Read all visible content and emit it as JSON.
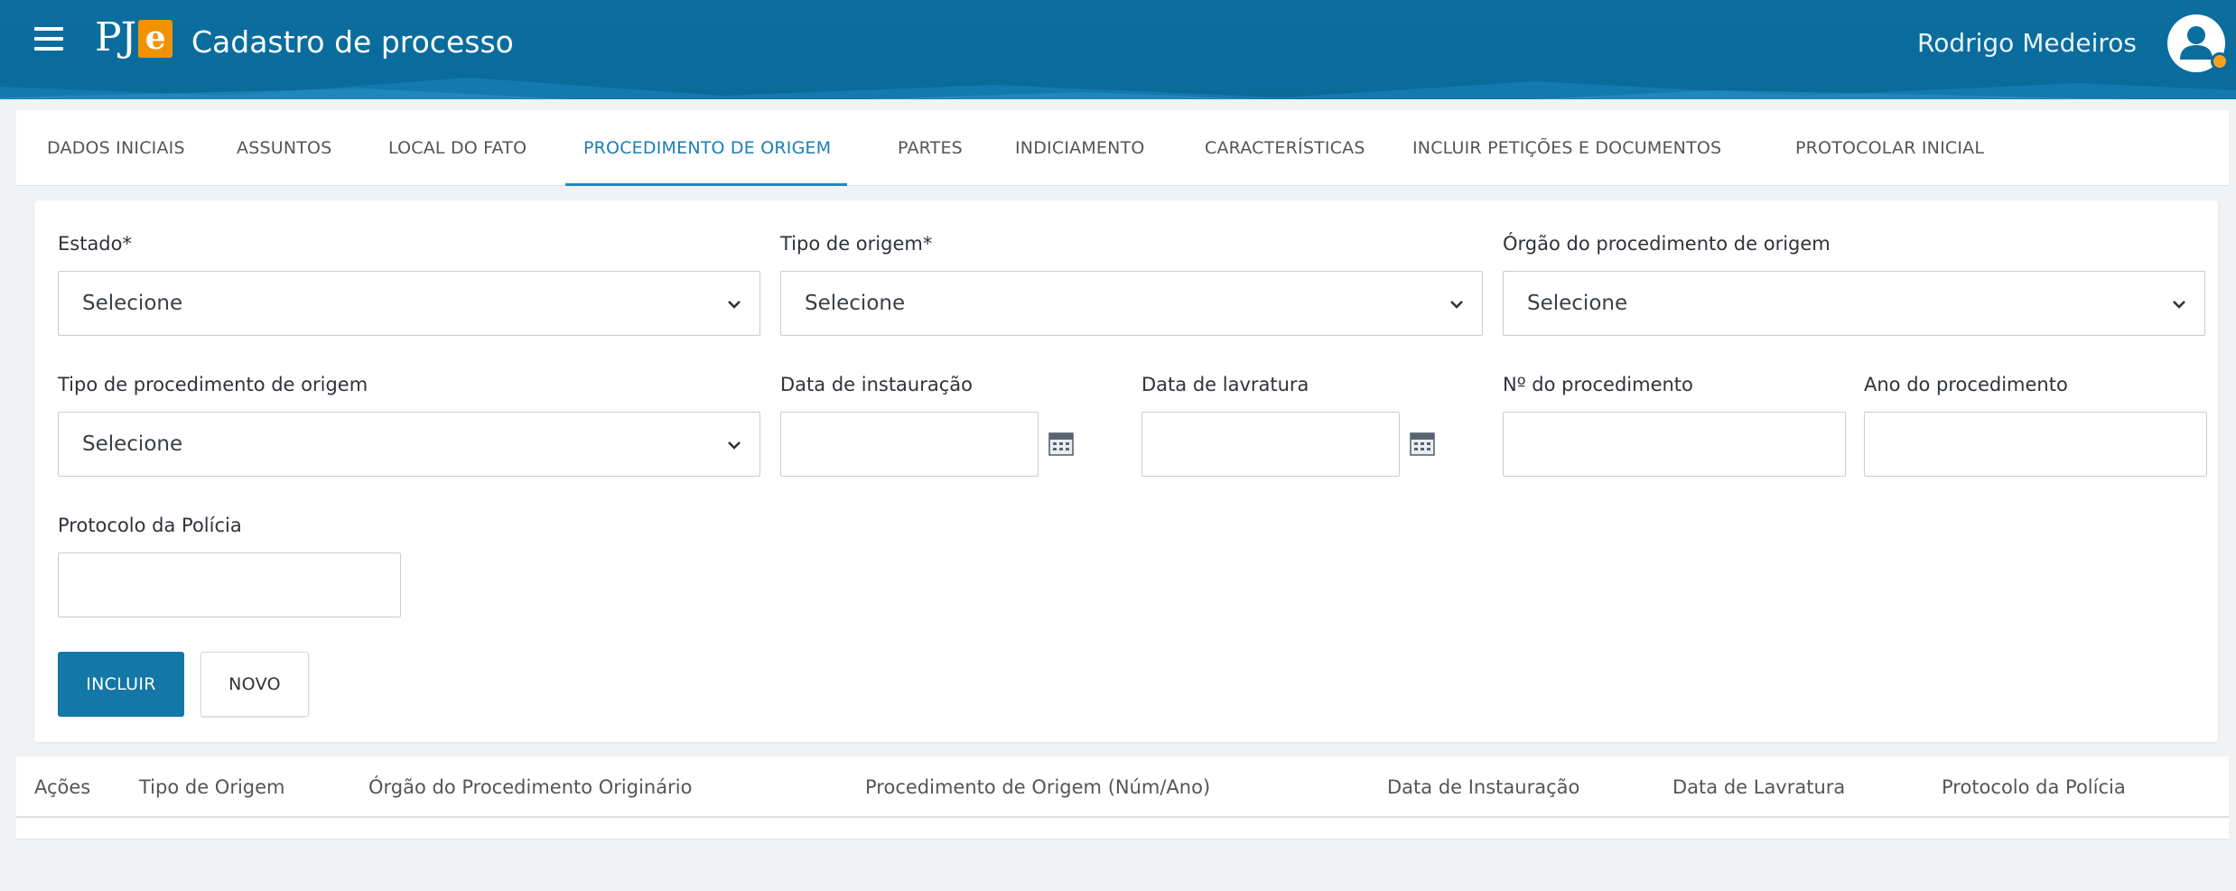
{
  "header": {
    "logo_text": "PJ",
    "logo_letter": "e",
    "title": "Cadastro de processo",
    "user_name": "Rodrigo Medeiros",
    "brand_color": "#0a6fa3",
    "accent_color": "#f39200"
  },
  "tabs": [
    {
      "label": "DADOS INICIAIS",
      "active": false
    },
    {
      "label": "ASSUNTOS",
      "active": false
    },
    {
      "label": "LOCAL DO FATO",
      "active": false
    },
    {
      "label": "PROCEDIMENTO DE ORIGEM",
      "active": true
    },
    {
      "label": "PARTES",
      "active": false
    },
    {
      "label": "INDICIAMENTO",
      "active": false
    },
    {
      "label": "CARACTERÍSTICAS",
      "active": false
    },
    {
      "label": "INCLUIR PETIÇÕES E DOCUMENTOS",
      "active": false
    },
    {
      "label": "PROTOCOLAR INICIAL",
      "active": false
    }
  ],
  "form": {
    "estado": {
      "label": "Estado*",
      "value": "Selecione"
    },
    "tipo_origem": {
      "label": "Tipo de origem*",
      "value": "Selecione"
    },
    "orgao": {
      "label": "Órgão do procedimento de origem",
      "value": "Selecione"
    },
    "tipo_procedimento": {
      "label": "Tipo de procedimento de origem",
      "value": "Selecione"
    },
    "data_instauracao": {
      "label": "Data de instauração",
      "value": ""
    },
    "data_lavratura": {
      "label": "Data de lavratura",
      "value": ""
    },
    "numero_procedimento": {
      "label": "Nº do procedimento",
      "value": ""
    },
    "ano_procedimento": {
      "label": "Ano do procedimento",
      "value": ""
    },
    "protocolo_policia": {
      "label": "Protocolo da Polícia",
      "value": ""
    }
  },
  "buttons": {
    "incluir": "INCLUIR",
    "novo": "NOVO"
  },
  "table": {
    "columns": [
      "Ações",
      "Tipo de Origem",
      "Órgão do Procedimento Originário",
      "Procedimento de Origem (Núm/Ano)",
      "Data de Instauração",
      "Data de Lavratura",
      "Protocolo da Polícia"
    ],
    "rows": []
  },
  "icons": {
    "menu": "hamburger-menu-icon",
    "user": "user-avatar-icon",
    "calendar": "calendar-icon",
    "dropdown": "chevron-down-icon"
  }
}
